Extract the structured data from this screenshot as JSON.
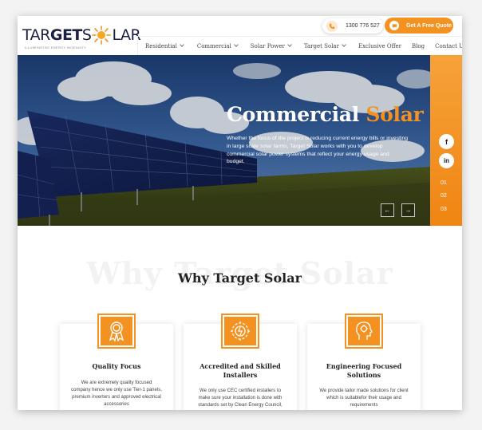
{
  "brand": {
    "logo_part1": "TAR",
    "logo_part2": "GET",
    "logo_part3": "S",
    "logo_part4": "LAR",
    "tagline": "ILLUMINATING ENERGY INGENUITY",
    "accent_color": "#f39220"
  },
  "header": {
    "phone": "1300 776 527",
    "quote_button": "Get A Free Quote"
  },
  "nav": {
    "items": [
      {
        "label": "Residential",
        "dropdown": true
      },
      {
        "label": "Commercial",
        "dropdown": true
      },
      {
        "label": "Solar Power",
        "dropdown": true
      },
      {
        "label": "Target Solar",
        "dropdown": true
      },
      {
        "label": "Exclusive Offer",
        "dropdown": false
      },
      {
        "label": "Blog",
        "dropdown": false
      },
      {
        "label": "Contact Us",
        "dropdown": false
      }
    ]
  },
  "hero": {
    "title_white": "Commercial",
    "title_accent": "Solar",
    "description": "Whether the focus of the project is reducing current energy bills or investing in large scale solar farms, Target Solar works with you to develop commercial solar power systems that reflect your energy usage and budget.",
    "prev_icon": "arrow-left-icon",
    "next_icon": "arrow-right-icon",
    "prev_glyph": "←",
    "next_glyph": "→"
  },
  "sidebar": {
    "facebook": "f",
    "linkedin": "in",
    "slides": [
      "01",
      "02",
      "03"
    ]
  },
  "why": {
    "watermark": "Why Target Solar",
    "title": "Why Target Solar",
    "cards": [
      {
        "icon": "award-ribbon-icon",
        "title": "Quality Focus",
        "text": "We are extremely quality focused company hence we only use Tier-1 panels, premium inverters and approved electrical accessories"
      },
      {
        "icon": "certified-sun-gear-icon",
        "title": "Accredited and Skilled Installers",
        "text": "We only use CEC certified installers to make sure your installation is done with standards set by Clean Energy Council,"
      },
      {
        "icon": "engineering-head-icon",
        "title": "Engineering Focused Solutions",
        "text": "We provide tailor made solutions for client which is suitablefor their usage and requirements"
      }
    ]
  }
}
